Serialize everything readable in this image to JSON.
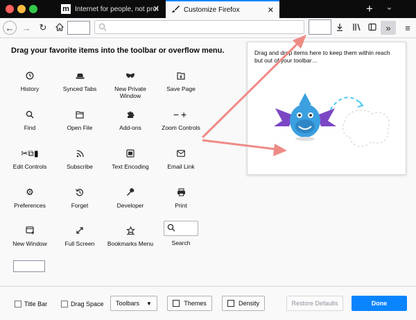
{
  "window": {
    "tabs": [
      {
        "title": "Internet for people, not profit —",
        "favicon": "m"
      },
      {
        "title": "Customize Firefox"
      }
    ],
    "new_tab": "+",
    "tab_list": "⌄"
  },
  "customize": {
    "heading": "Drag your favorite items into the toolbar or overflow menu.",
    "items": [
      {
        "label": "History",
        "icon": "clock-icon"
      },
      {
        "label": "Synced Tabs",
        "icon": "laptop-icon"
      },
      {
        "label": "New Private Window",
        "icon": "mask-icon"
      },
      {
        "label": "Save Page",
        "icon": "save-page-icon"
      },
      {
        "label": "Find",
        "icon": "search-icon"
      },
      {
        "label": "Open File",
        "icon": "folder-icon"
      },
      {
        "label": "Add-ons",
        "icon": "puzzle-icon"
      },
      {
        "label": "Zoom Controls",
        "icon": "zoom-icon"
      },
      {
        "label": "Edit Controls",
        "icon": "scissors-icon"
      },
      {
        "label": "Subscribe",
        "icon": "rss-icon"
      },
      {
        "label": "Text Encoding",
        "icon": "text-encoding-icon"
      },
      {
        "label": "Email Link",
        "icon": "envelope-icon"
      },
      {
        "label": "Preferences",
        "icon": "gear-icon"
      },
      {
        "label": "Forget",
        "icon": "forget-icon"
      },
      {
        "label": "Developer",
        "icon": "wrench-icon"
      },
      {
        "label": "Print",
        "icon": "printer-icon"
      },
      {
        "label": "New Window",
        "icon": "new-window-icon"
      },
      {
        "label": "Full Screen",
        "icon": "fullscreen-icon"
      },
      {
        "label": "Bookmarks Menu",
        "icon": "bookmarks-icon"
      },
      {
        "label": "Search",
        "icon": "search-icon"
      }
    ]
  },
  "overflow_panel": {
    "text": "Drag and drop items here to keep them within reach but out of your toolbar…"
  },
  "footer": {
    "title_bar": "Title Bar",
    "drag_space": "Drag Space",
    "toolbars": "Toolbars",
    "themes": "Themes",
    "density": "Density",
    "restore_defaults": "Restore Defaults",
    "done": "Done"
  },
  "colors": {
    "accent": "#0a84ff",
    "arrow": "#ee8b85",
    "mascot": "#3b9fe0"
  }
}
